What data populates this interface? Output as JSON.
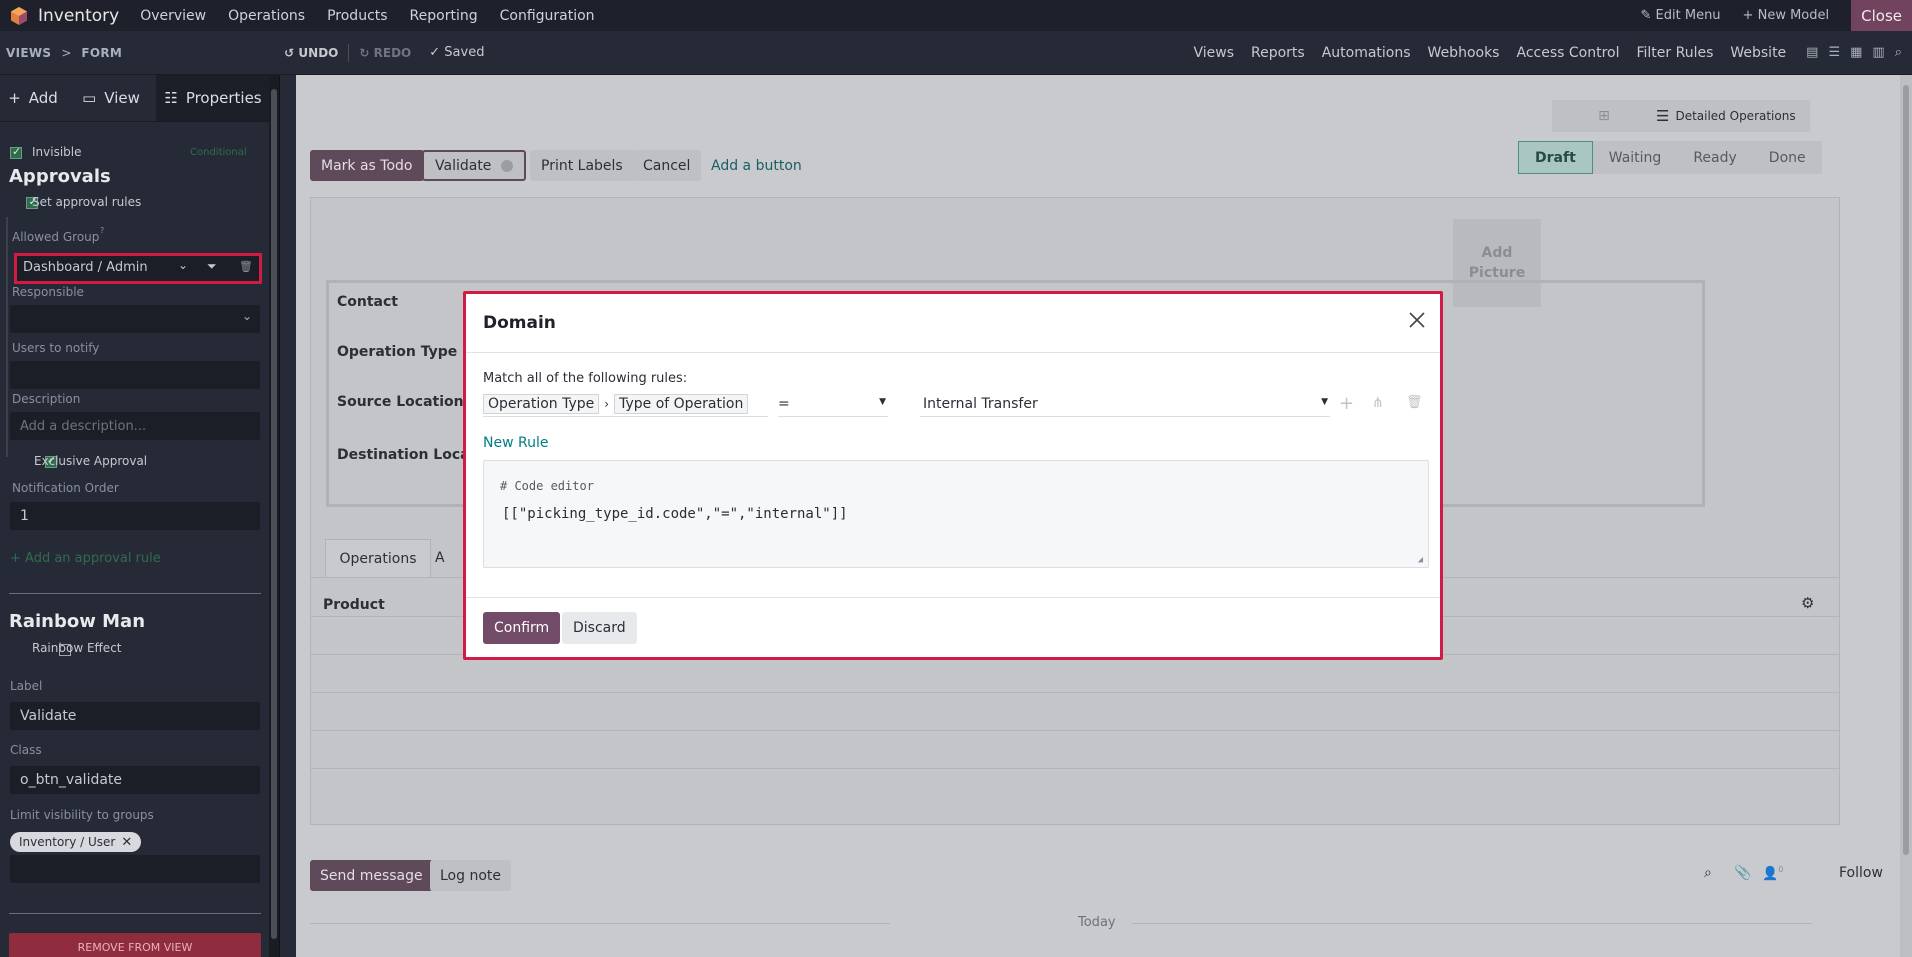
{
  "topbar": {
    "app_name": "Inventory",
    "menus": [
      "Overview",
      "Operations",
      "Products",
      "Reporting",
      "Configuration"
    ],
    "edit_menu": "Edit Menu",
    "new_model": "New Model",
    "close": "Close"
  },
  "subbar": {
    "breadcrumb": [
      "VIEWS",
      "FORM"
    ],
    "breadcrumb_sep": ">",
    "undo": "UNDO",
    "redo": "REDO",
    "saved": "Saved",
    "links": [
      "Views",
      "Reports",
      "Automations",
      "Webhooks",
      "Access Control",
      "Filter Rules",
      "Website"
    ]
  },
  "sidebar": {
    "tabs": [
      "Add",
      "View",
      "Properties"
    ],
    "invisible": "Invisible",
    "conditional": "Conditional",
    "approvals_title": "Approvals",
    "set_approval_rules": "Set approval rules",
    "allowed_group_label": "Allowed Group",
    "allowed_group_value": "Dashboard / Admin",
    "responsible_label": "Responsible",
    "users_to_notify_label": "Users to notify",
    "description_label": "Description",
    "description_placeholder": "Add a description...",
    "exclusive_approval": "Exclusive Approval",
    "notification_order_label": "Notification Order",
    "notification_order_value": "1",
    "add_approval_rule": "Add an approval rule",
    "rainbow_title": "Rainbow Man",
    "rainbow_effect": "Rainbow Effect",
    "label_label": "Label",
    "label_value": "Validate",
    "class_label": "Class",
    "class_value": "o_btn_validate",
    "limit_visibility_label": "Limit visibility to groups",
    "group_tag": "Inventory / User",
    "remove_from_view": "REMOVE FROM VIEW"
  },
  "form": {
    "buttons": {
      "mark_as_todo": "Mark as Todo",
      "validate": "Validate",
      "print_labels": "Print Labels",
      "cancel": "Cancel",
      "add_button": "Add a button"
    },
    "detailed_operations": "Detailed Operations",
    "statuses": [
      "Draft",
      "Waiting",
      "Ready",
      "Done"
    ],
    "add_picture": "Add Picture",
    "fields": [
      "Contact",
      "Operation Type",
      "Source Location",
      "Destination Location"
    ],
    "tabs": [
      "Operations",
      "A"
    ],
    "product_header": "Product",
    "send_message": "Send message",
    "log_note": "Log note",
    "followers_count": "0",
    "follow": "Follow",
    "today": "Today"
  },
  "dialog": {
    "title": "Domain",
    "match_text": "Match all of the following rules:",
    "path": [
      "Operation Type",
      "Type of Operation"
    ],
    "operator": "=",
    "value": "Internal Transfer",
    "new_rule": "New Rule",
    "code_comment": "# Code editor",
    "code": "[[\"picking_type_id.code\",\"=\",\"internal\"]]",
    "confirm": "Confirm",
    "discard": "Discard"
  },
  "colors": {
    "primary": "#714b67",
    "accent_teal": "#017e84",
    "highlight_red": "#d01c45"
  }
}
